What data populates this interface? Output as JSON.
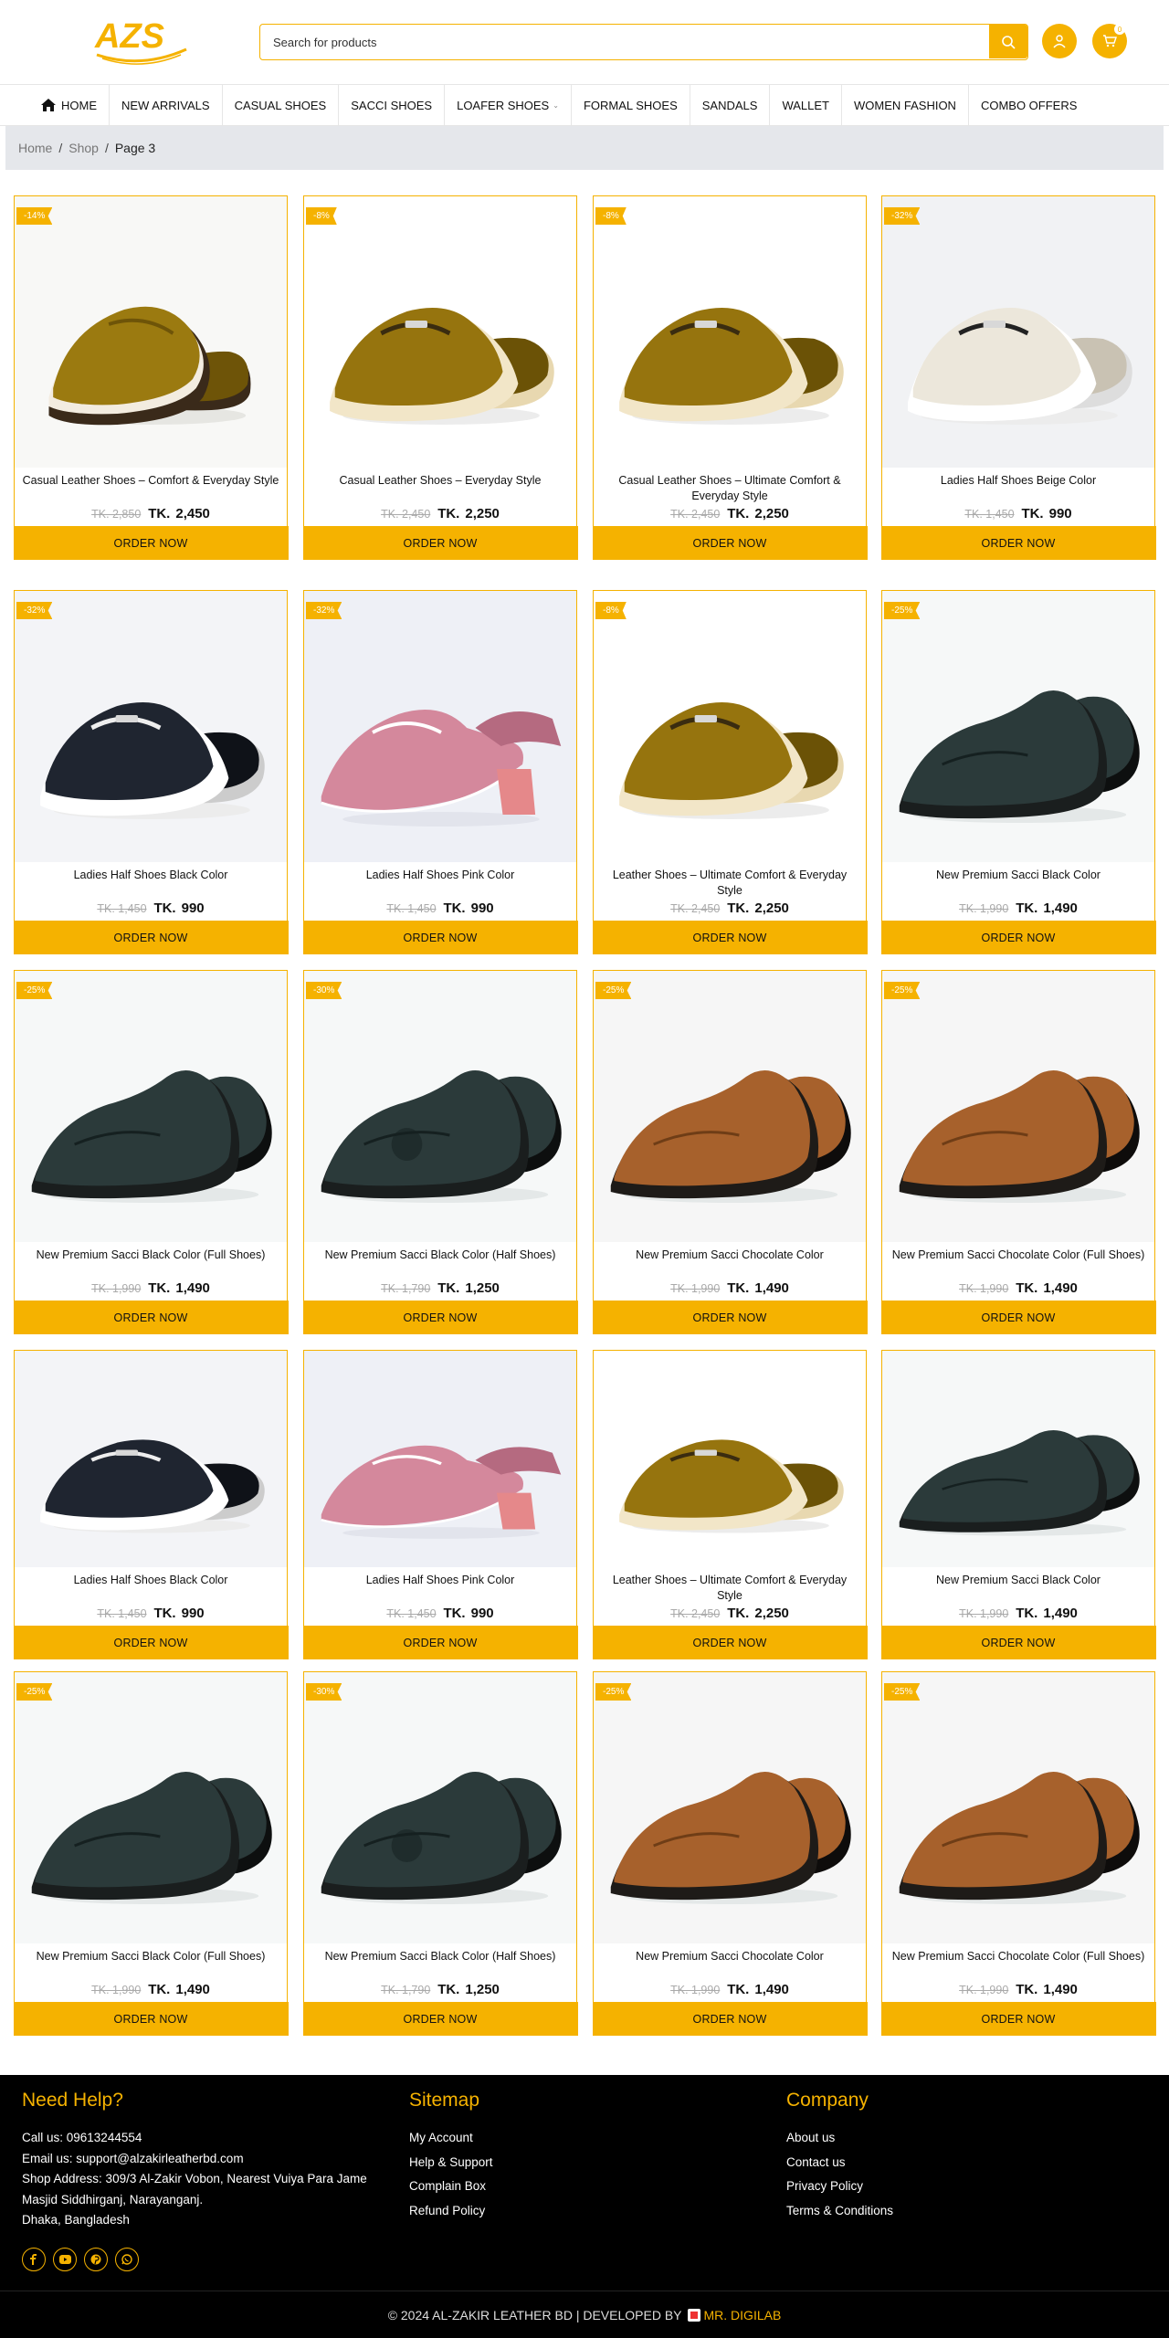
{
  "brand": {
    "logo_text": "AZS",
    "accent": "#f5b200"
  },
  "search": {
    "placeholder": "Search for products"
  },
  "header": {
    "cart_count": "0"
  },
  "nav": [
    {
      "label": "HOME",
      "icon": "home-icon"
    },
    {
      "label": "NEW ARRIVALS"
    },
    {
      "label": "CASUAL SHOES"
    },
    {
      "label": "SACCI SHOES"
    },
    {
      "label": "LOAFER SHOES",
      "has_dropdown": true
    },
    {
      "label": "FORMAL SHOES"
    },
    {
      "label": "SANDALS"
    },
    {
      "label": "WALLET"
    },
    {
      "label": "WOMEN FASHION"
    },
    {
      "label": "COMBO OFFERS"
    }
  ],
  "breadcrumb": {
    "home": "Home",
    "shop": "Shop",
    "current": "Page 3"
  },
  "currency": "TK.",
  "order_label": "ORDER NOW",
  "products": [
    {
      "badge": "-14%",
      "title": "Casual Leather Shoes – Comfort & Everyday Style",
      "old": "TK. 2,850",
      "price": "2,450",
      "shoe": "loafer-olive"
    },
    {
      "badge": "-8%",
      "title": "Casual Leather Shoes – Everyday Style",
      "old": "TK. 2,450",
      "price": "2,250",
      "shoe": "mule-olive"
    },
    {
      "badge": "-8%",
      "title": "Casual Leather Shoes – Ultimate Comfort & Everyday Style",
      "old": "TK. 2,450",
      "price": "2,250",
      "shoe": "mule-olive"
    },
    {
      "badge": "-32%",
      "title": "Ladies Half Shoes Beige Color",
      "old": "TK. 1,450",
      "price": "990",
      "shoe": "mule-beige"
    },
    {
      "badge": "-32%",
      "title": "Ladies Half Shoes Black Color",
      "old": "TK. 1,450",
      "price": "990",
      "shoe": "mule-black"
    },
    {
      "badge": "-32%",
      "title": "Ladies Half Shoes Pink Color",
      "old": "TK. 1,450",
      "price": "990",
      "shoe": "heel-pink"
    },
    {
      "badge": "-8%",
      "title": "Leather Shoes – Ultimate Comfort & Everyday Style",
      "old": "TK. 2,450",
      "price": "2,250",
      "shoe": "mule-olive"
    },
    {
      "badge": "-25%",
      "title": "New Premium Sacci Black Color",
      "old": "TK. 1,990",
      "price": "1,490",
      "shoe": "sacci-black"
    },
    {
      "badge": "-25%",
      "title": "New Premium Sacci Black Color (Full Shoes)",
      "old": "TK. 1,990",
      "price": "1,490",
      "shoe": "sacci-black"
    },
    {
      "badge": "-30%",
      "title": "New Premium Sacci Black Color (Half Shoes)",
      "old": "TK. 1,790",
      "price": "1,250",
      "shoe": "sacci-black-half"
    },
    {
      "badge": "-25%",
      "title": "New Premium Sacci Chocolate Color",
      "old": "TK. 1,990",
      "price": "1,490",
      "shoe": "sacci-brown"
    },
    {
      "badge": "-25%",
      "title": "New Premium Sacci Chocolate Color (Full Shoes)",
      "old": "TK. 1,990",
      "price": "1,490",
      "shoe": "sacci-brown"
    },
    {
      "badge": "",
      "title": "Ladies Half Shoes Black Color",
      "old": "TK. 1,450",
      "price": "990",
      "shoe": "mule-black"
    },
    {
      "badge": "",
      "title": "Ladies Half Shoes Pink Color",
      "old": "TK. 1,450",
      "price": "990",
      "shoe": "heel-pink"
    },
    {
      "badge": "",
      "title": "Leather Shoes – Ultimate Comfort & Everyday Style",
      "old": "TK. 2,450",
      "price": "2,250",
      "shoe": "mule-olive"
    },
    {
      "badge": "",
      "title": "New Premium Sacci Black Color",
      "old": "TK. 1,990",
      "price": "1,490",
      "shoe": "sacci-black"
    },
    {
      "badge": "-25%",
      "title": "New Premium Sacci Black Color (Full Shoes)",
      "old": "TK. 1,990",
      "price": "1,490",
      "shoe": "sacci-black"
    },
    {
      "badge": "-30%",
      "title": "New Premium Sacci Black Color (Half Shoes)",
      "old": "TK. 1,790",
      "price": "1,250",
      "shoe": "sacci-black-half"
    },
    {
      "badge": "-25%",
      "title": "New Premium Sacci Chocolate Color",
      "old": "TK. 1,990",
      "price": "1,490",
      "shoe": "sacci-brown"
    },
    {
      "badge": "-25%",
      "title": "New Premium Sacci Chocolate Color (Full Shoes)",
      "old": "TK. 1,990",
      "price": "1,490",
      "shoe": "sacci-brown"
    }
  ],
  "footer": {
    "help": {
      "heading": "Need Help?",
      "call": "Call us: 09613244554",
      "email": "Email us: support@alzakirleatherbd.com",
      "address1": "Shop Address: 309/3 Al-Zakir Vobon, Nearest Vuiya Para Jame",
      "address2": "Masjid Siddhirganj, Narayanganj.",
      "address3": "Dhaka, Bangladesh"
    },
    "sitemap": {
      "heading": "Sitemap",
      "links": [
        "My Account",
        "Help & Support",
        "Complain Box",
        "Refund Policy"
      ]
    },
    "company": {
      "heading": "Company",
      "links": [
        "About us",
        "Contact us",
        "Privacy Policy",
        "Terms & Conditions"
      ]
    },
    "social": [
      "facebook-icon",
      "youtube-icon",
      "pinterest-icon",
      "whatsapp-icon"
    ],
    "copyright": "© 2024 AL-ZAKIR LEATHER BD | DEVELOPED BY",
    "developer": "MR. DIGILAB"
  }
}
